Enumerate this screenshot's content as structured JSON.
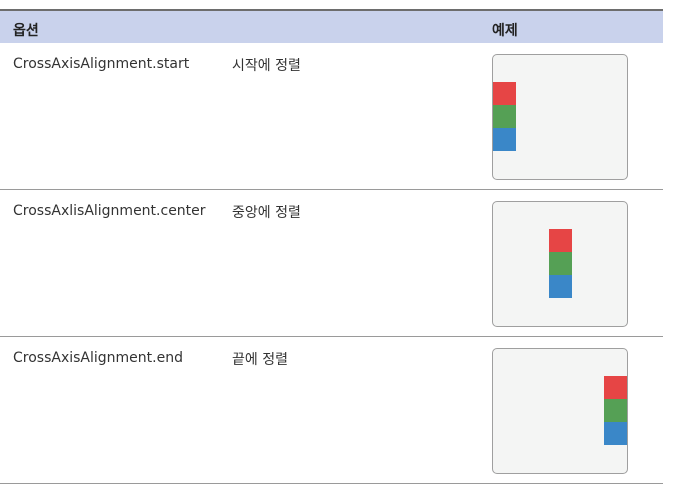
{
  "table": {
    "headers": {
      "option": "옵션",
      "example": "예제"
    },
    "rows": [
      {
        "option": "CrossAxisAlignment.start",
        "description": "시작에 정렬",
        "align": "start"
      },
      {
        "option": "CrossAxlisAlignment.center",
        "description": "중앙에 정렬",
        "align": "center"
      },
      {
        "option": "CrossAxisAlignment.end",
        "description": "끝에 정렬",
        "align": "end"
      }
    ]
  },
  "colors": {
    "header_bg": "#c9d2ec",
    "box_red": "#e64545",
    "box_green": "#55a055",
    "box_blue": "#3a87c8"
  }
}
